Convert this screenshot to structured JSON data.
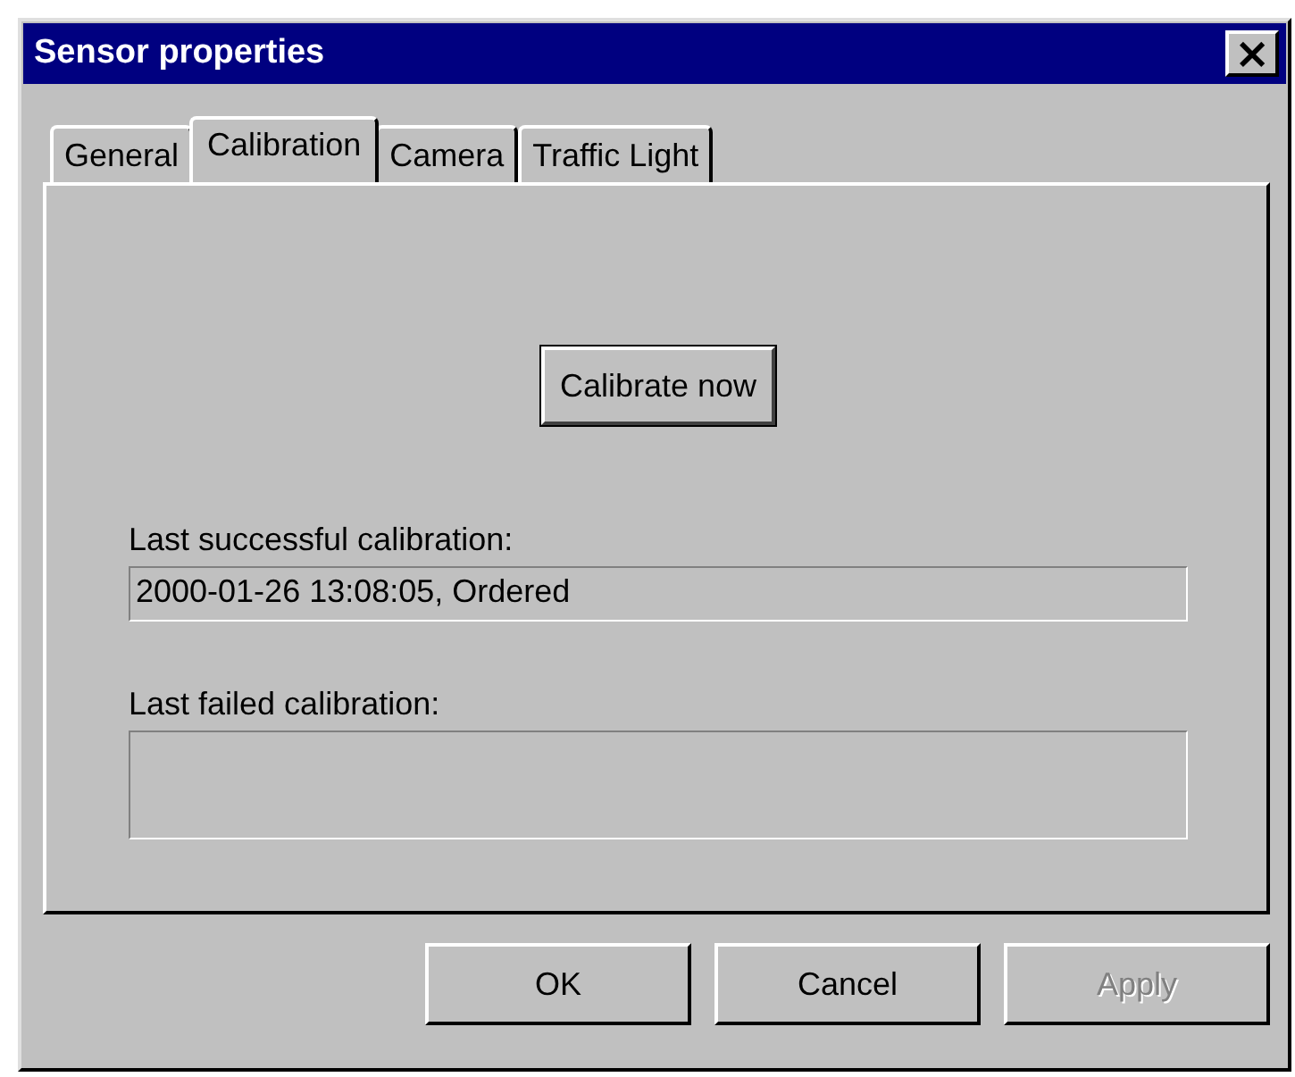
{
  "window": {
    "title": "Sensor properties",
    "close": "×"
  },
  "tabs": [
    {
      "label": "General",
      "selected": false
    },
    {
      "label": "Calibration",
      "selected": true
    },
    {
      "label": "Camera",
      "selected": false
    },
    {
      "label": "Traffic Light",
      "selected": false
    }
  ],
  "calibrate_button": "Calibrate now",
  "fields": [
    {
      "label": "Last successful calibration:",
      "value": "2000-01-26 13:08:05, Ordered",
      "kind": "single"
    },
    {
      "label": "Last failed calibration:",
      "kind": "multi"
    }
  ],
  "buttons": [
    {
      "label": "OK",
      "disabled": false
    },
    {
      "label": "Cancel",
      "disabled": false
    },
    {
      "label": "Apply",
      "disabled": true
    }
  ]
}
